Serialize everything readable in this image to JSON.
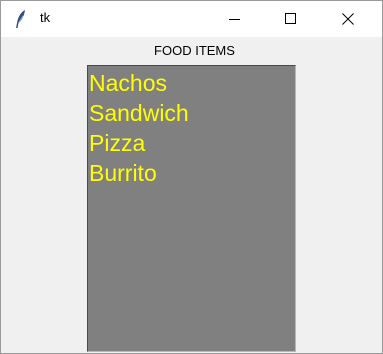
{
  "window": {
    "title": "tk",
    "icon": "feather-icon",
    "controls": [
      "minimize-icon",
      "maximize-icon",
      "close-icon"
    ]
  },
  "heading": "FOOD ITEMS",
  "listbox": {
    "background": "#808080",
    "foreground": "#ffff00",
    "items": [
      "Nachos",
      "Sandwich",
      "Pizza",
      "Burrito"
    ]
  }
}
